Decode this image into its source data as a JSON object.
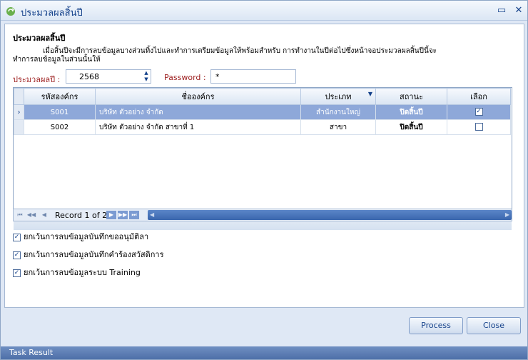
{
  "window": {
    "title": "ประมวลผลสิ้นปี"
  },
  "panel": {
    "heading": "ประมวลผลสิ้นปี",
    "description_line1": "เมื่อสิ้นปีจะมีการลบข้อมูลบางส่วนทิ้งไปและทำการเตรียมข้อมูลให้พร้อมสำหรับ การทำงานในปีต่อไปซึ่งหน้าจอประมวลผลสิ้นปีนี้จะ",
    "description_line2": "ทำการลบข้อมูลในส่วนนั้นให้"
  },
  "form": {
    "year_label": "ประมวลผลปี :",
    "year_value": "2568",
    "password_label": "Password :",
    "password_value": "*"
  },
  "grid": {
    "columns": [
      "รหัสองค์กร",
      "ชื่อองค์กร",
      "ประเภท",
      "สถานะ",
      "เลือก"
    ],
    "rows": [
      {
        "code": "S001",
        "name": "บริษัท ตัวอย่าง จำกัด",
        "type": "สำนักงานใหญ่",
        "status": "ปิดสิ้นปี",
        "checked": "✓"
      },
      {
        "code": "S002",
        "name": "บริษัท ตัวอย่าง จำกัด สาขาที่ 1",
        "type": "สาขา",
        "status": "ปิดสิ้นปี",
        "checked": ""
      }
    ],
    "record_text": "Record 1 of 2"
  },
  "options": [
    {
      "label": "ยกเว้นการลบข้อมูลบันทึกขออนุมัติลา",
      "checked": "✓"
    },
    {
      "label": "ยกเว้นการลบข้อมูลบันทึกคำร้องสวัสดิการ",
      "checked": "✓"
    },
    {
      "label": "ยกเว้นการลบข้อมูลระบบ Training",
      "checked": "✓"
    }
  ],
  "buttons": {
    "process": "Process",
    "close": "Close"
  },
  "taskbar": {
    "label": "Task Result"
  },
  "icons": {
    "app": "recycle-icon",
    "minimize": "minimize-icon",
    "close": "close-icon",
    "filter": "filter-icon"
  },
  "colors": {
    "accent": "#15428b",
    "selected_row": "#8ea8d9",
    "label_red": "#9c1c1c"
  }
}
